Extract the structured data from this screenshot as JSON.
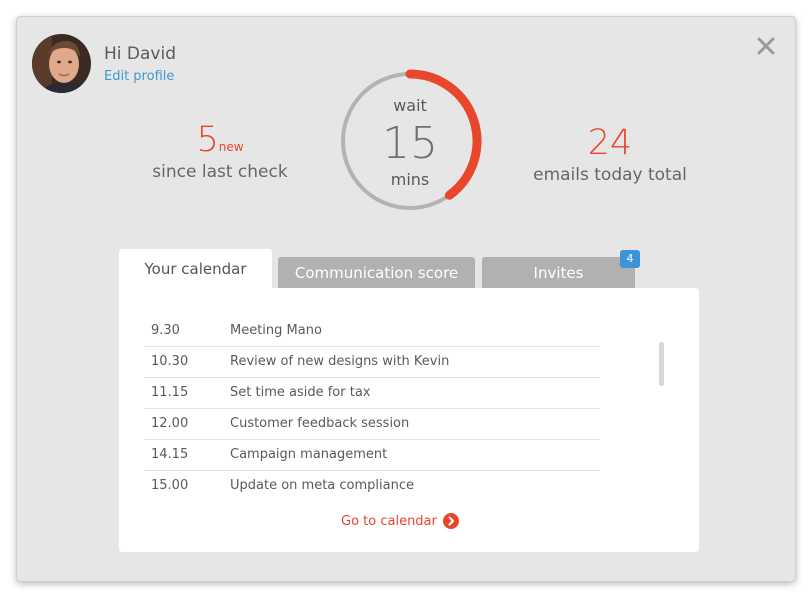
{
  "header": {
    "greeting": "Hi David",
    "edit_profile": "Edit profile"
  },
  "stats": {
    "new_count": "5",
    "new_tag": "new",
    "new_label": "since last check",
    "total_count": "24",
    "total_label": "emails today total"
  },
  "timer": {
    "top_label": "wait",
    "value": "15",
    "unit": "mins",
    "progress_fraction": 0.4
  },
  "tabs": [
    {
      "label": "Your calendar",
      "active": true
    },
    {
      "label": "Communication score",
      "active": false
    },
    {
      "label": "Invites",
      "active": false,
      "badge": "4"
    }
  ],
  "calendar": {
    "events": [
      {
        "time": "9.30",
        "title": "Meeting Mano"
      },
      {
        "time": "10.30",
        "title": "Review of new designs with Kevin"
      },
      {
        "time": "11.15",
        "title": "Set time aside for tax"
      },
      {
        "time": "12.00",
        "title": "Customer feedback session"
      },
      {
        "time": "14.15",
        "title": "Campaign management"
      },
      {
        "time": "15.00",
        "title": "Update on meta compliance"
      }
    ],
    "goto_label": "Go to calendar"
  },
  "icons": {
    "close": "close-icon",
    "goto": "chevron-right-icon"
  },
  "colors": {
    "accent": "#e8472b",
    "link": "#3d9ad1",
    "badge": "#3a95d8",
    "ring_track": "#b3b3b3"
  }
}
